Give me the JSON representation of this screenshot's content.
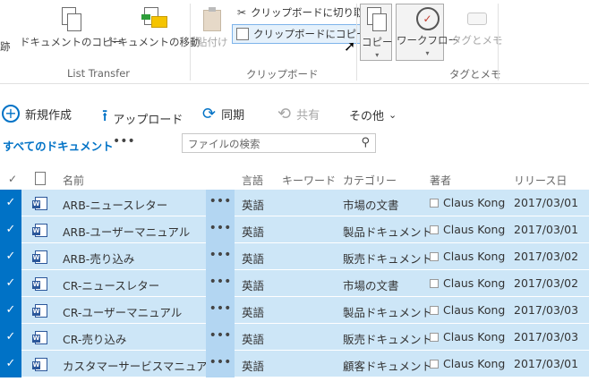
{
  "ribbon": {
    "partial_label": "跡",
    "copy_doc_label": "ドキュメントのコピー",
    "move_doc_label": "ドキュメントの移動",
    "list_transfer_group": "List Transfer",
    "paste_label": "貼付け",
    "cut_label": "クリップボードに切り取り",
    "copy_clip_label": "クリップボードにコピー",
    "clipboard_group": "クリップボード",
    "copy_label": "コピー",
    "workflow_label": "ワークフロー",
    "tags_label": "タグとメモ",
    "tags_group": "タグとメモ"
  },
  "commands": {
    "new": "新規作成",
    "upload": "アップロード",
    "sync": "同期",
    "share": "共有",
    "more": "その他"
  },
  "view": {
    "all_docs": "すべてのドキュメント",
    "more_dots": "•••"
  },
  "search": {
    "placeholder": "ファイルの検索"
  },
  "columns": {
    "check": "✓",
    "name": "名前",
    "language": "言語",
    "keyword": "キーワード",
    "category": "カテゴリー",
    "author": "著者",
    "release": "リリース日"
  },
  "rows": [
    {
      "name": "ARB-ニュースレター",
      "language": "英語",
      "category": "市場の文書",
      "author": "Claus Kong",
      "date": "2017/03/01"
    },
    {
      "name": "ARB-ユーザーマニュアル",
      "language": "英語",
      "category": "製品ドキュメント",
      "author": "Claus Kong",
      "date": "2017/03/01"
    },
    {
      "name": "ARB-売り込み",
      "language": "英語",
      "category": "販売ドキュメント",
      "author": "Claus Kong",
      "date": "2017/03/02"
    },
    {
      "name": "CR-ニュースレター",
      "language": "英語",
      "category": "市場の文書",
      "author": "Claus Kong",
      "date": "2017/03/02"
    },
    {
      "name": "CR-ユーザーマニュアル",
      "language": "英語",
      "category": "製品ドキュメント",
      "author": "Claus Kong",
      "date": "2017/03/03"
    },
    {
      "name": "CR-売り込み",
      "language": "英語",
      "category": "販売ドキュメント",
      "author": "Claus Kong",
      "date": "2017/03/03"
    },
    {
      "name": "カスタマーサービスマニュアル",
      "language": "英語",
      "category": "顧客ドキュメント",
      "author": "Claus Kong",
      "date": "2017/03/01"
    }
  ],
  "row_check": "✓",
  "row_dots": "•••",
  "colors": {
    "accent": "#0072c6",
    "selected_row": "#cde6f7",
    "check_col": "#0072c6"
  }
}
